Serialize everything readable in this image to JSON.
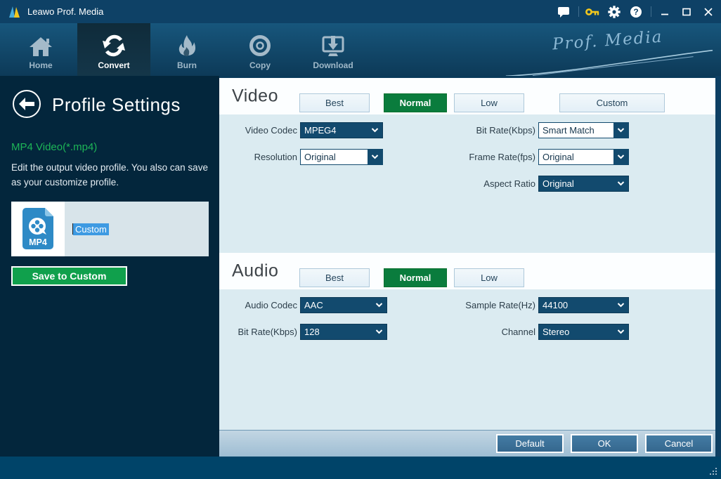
{
  "colors": {
    "title_bar": "#0e4166",
    "sidebar_navy": "#03263c",
    "panel_blue": "#dbebf1",
    "dropdown_navy": "#124a6e",
    "accent_green": "#0a7c3d",
    "profile_green": "#1db557",
    "selection_blue": "#3e9ae2",
    "key_yellow": "#f2c71d"
  },
  "titlebar": {
    "title": "Leawo Prof. Media"
  },
  "nav": {
    "tabs": [
      {
        "label": "Home"
      },
      {
        "label": "Convert",
        "active": true
      },
      {
        "label": "Burn"
      },
      {
        "label": "Copy"
      },
      {
        "label": "Download"
      }
    ],
    "signature": "Prof. Media"
  },
  "sidebar": {
    "title": "Profile Settings",
    "profile_name": "MP4 Video(*.mp4)",
    "description": "Edit the output video profile. You also can save as your customize profile.",
    "profile_item": {
      "icon_label": "MP4",
      "name_value": "Custom"
    },
    "save_button_label": "Save to Custom"
  },
  "video": {
    "title": "Video",
    "quality": [
      {
        "label": "Best",
        "active": false
      },
      {
        "label": "Normal",
        "active": true
      },
      {
        "label": "Low",
        "active": false
      },
      {
        "label": "Custom",
        "active": false
      }
    ],
    "fields": [
      {
        "label": "Video Codec",
        "value": "MPEG4"
      },
      {
        "label": "Bit Rate(Kbps)",
        "value": "Smart Match"
      },
      {
        "label": "Resolution",
        "value": "Original"
      },
      {
        "label": "Frame Rate(fps)",
        "value": "Original"
      },
      {
        "label": "Aspect Ratio",
        "value": "Original"
      }
    ]
  },
  "audio": {
    "title": "Audio",
    "quality": [
      {
        "label": "Best",
        "active": false
      },
      {
        "label": "Normal",
        "active": true
      },
      {
        "label": "Low",
        "active": false
      }
    ],
    "fields": [
      {
        "label": "Audio Codec",
        "value": "AAC"
      },
      {
        "label": "Sample Rate(Hz)",
        "value": "44100"
      },
      {
        "label": "Bit Rate(Kbps)",
        "value": "128"
      },
      {
        "label": "Channel",
        "value": "Stereo"
      }
    ]
  },
  "footer": {
    "buttons": [
      {
        "label": "Default"
      },
      {
        "label": "OK"
      },
      {
        "label": "Cancel"
      }
    ]
  }
}
